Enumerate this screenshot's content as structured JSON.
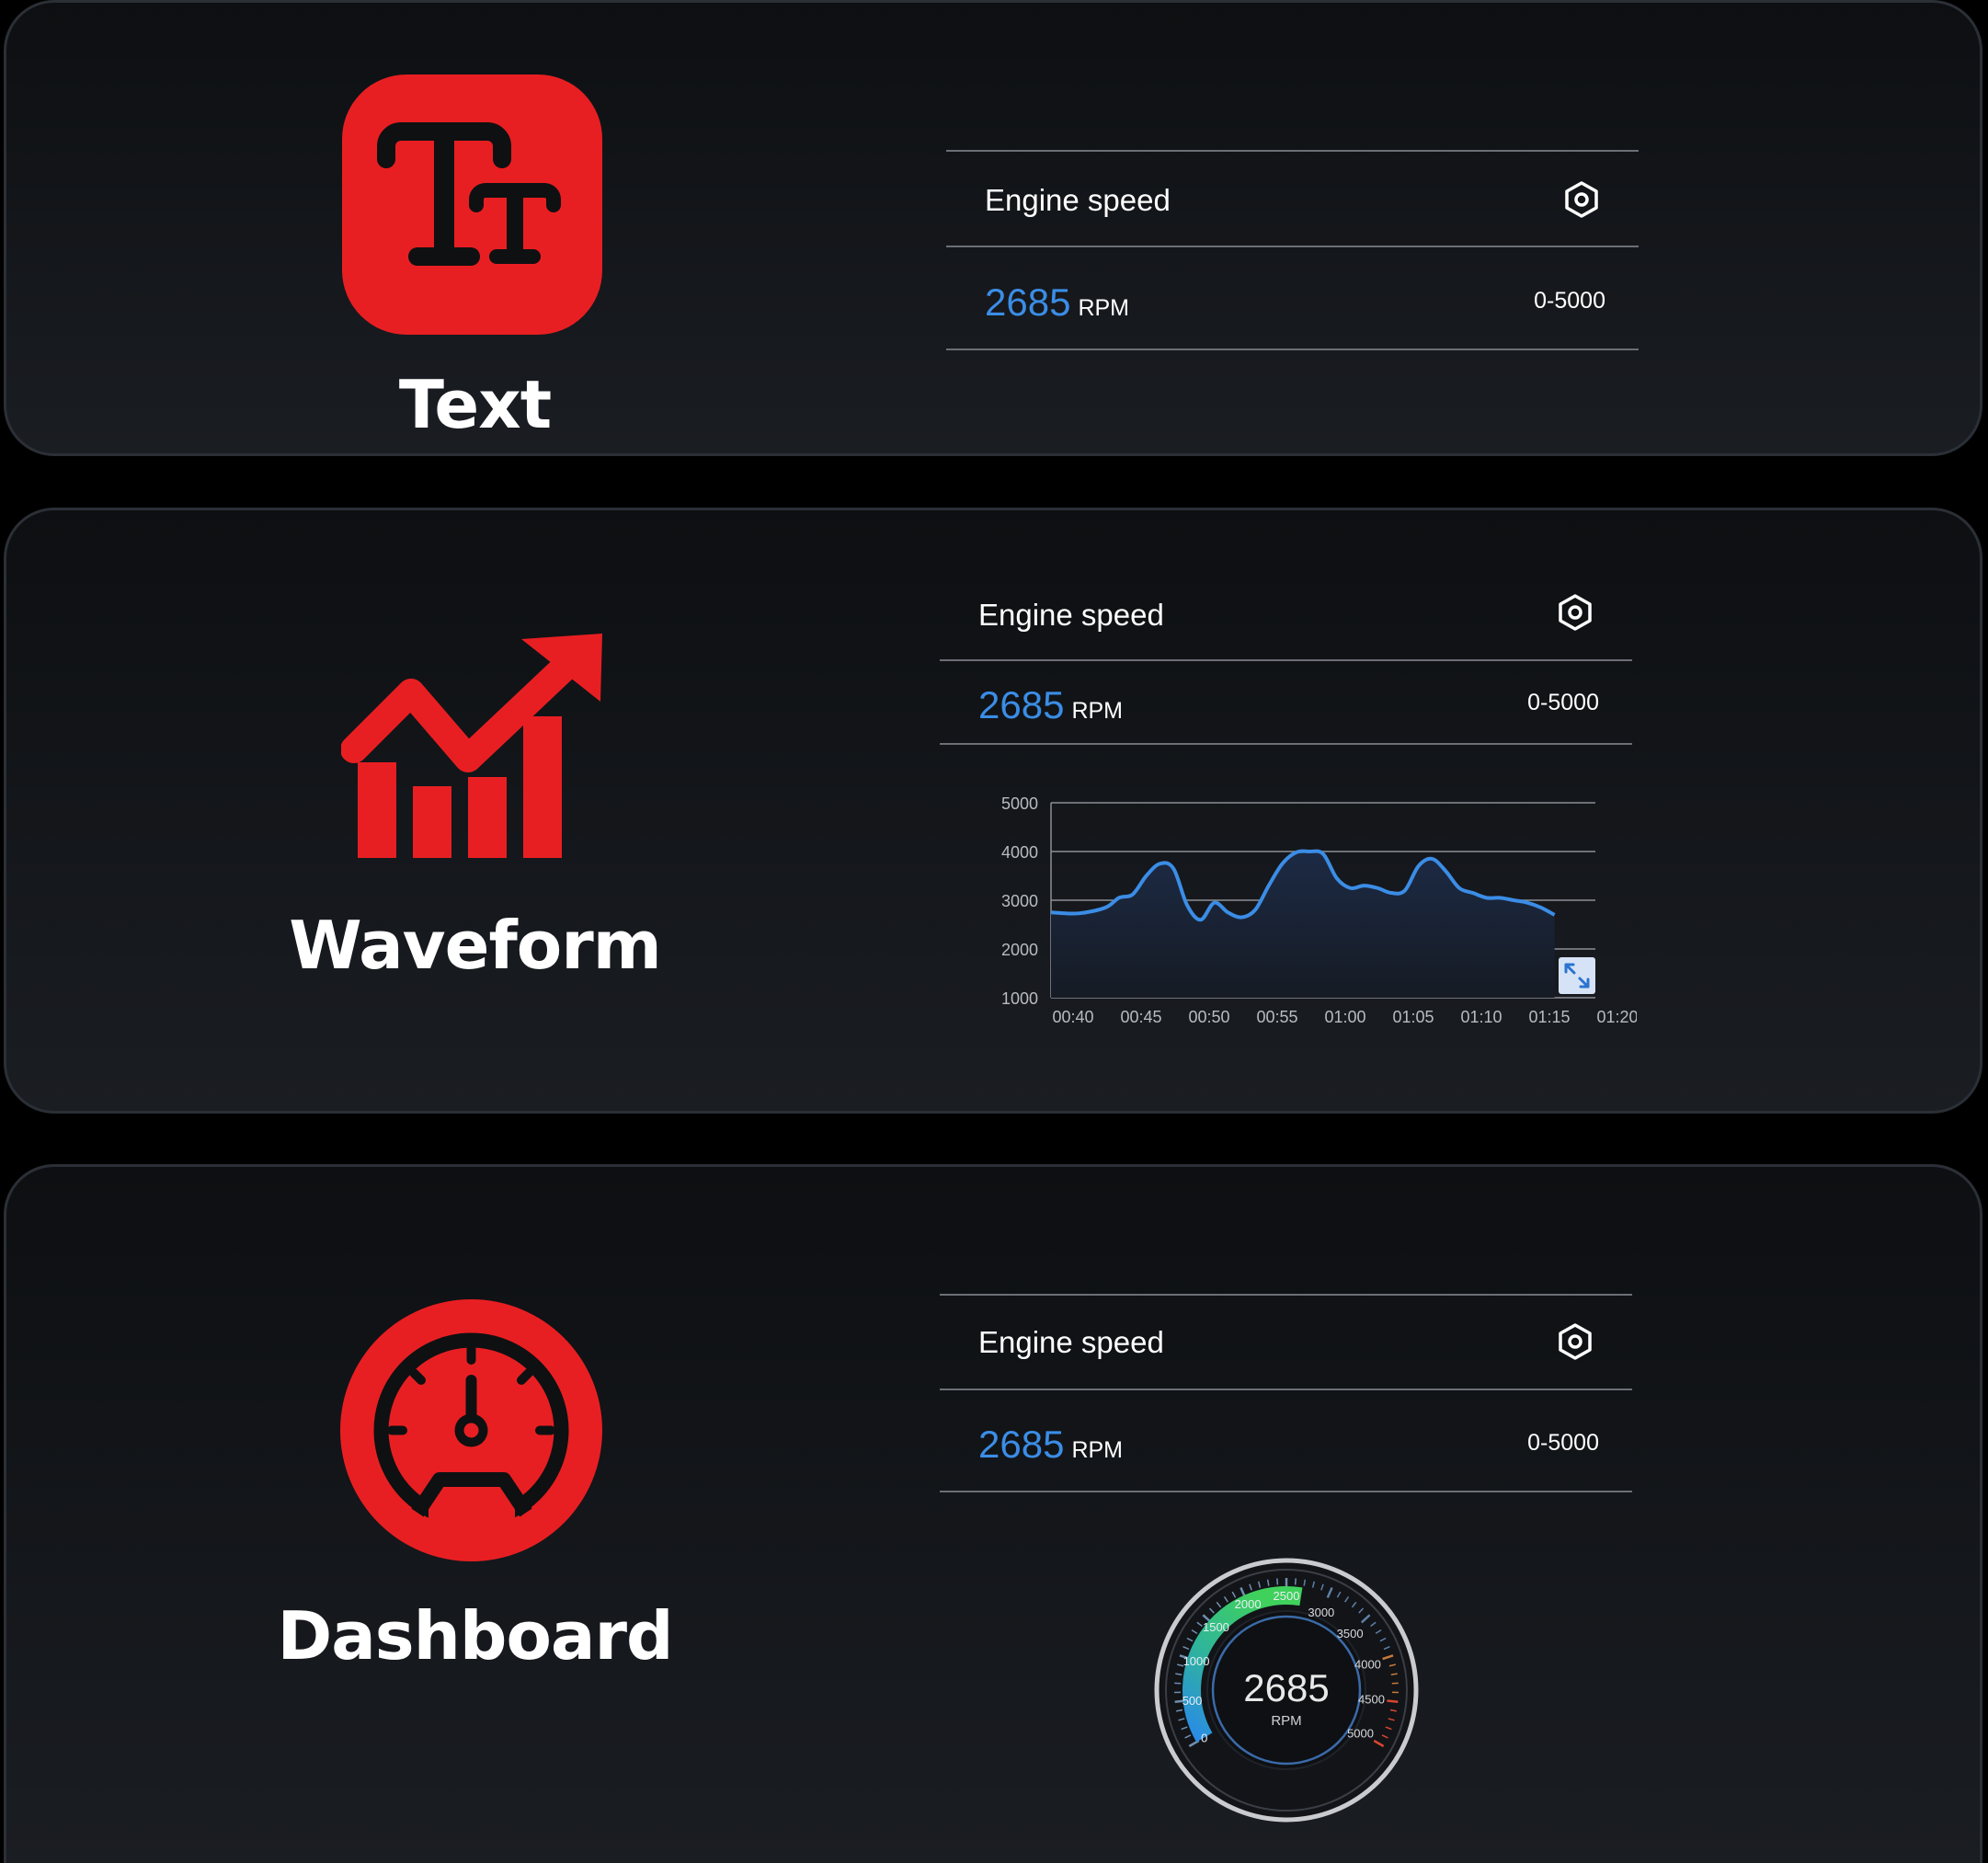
{
  "colors": {
    "accent_red": "#e81f22",
    "value_blue": "#3b8de6",
    "gauge_green": "#3fd15c",
    "gauge_blue": "#2a8ae8"
  },
  "modes": [
    {
      "title": "Text",
      "icon": "text-size-icon",
      "widget": {
        "title": "Engine speed",
        "value": "2685",
        "unit": "RPM",
        "range": "0-5000",
        "settings_icon": "settings-hexagon-icon"
      }
    },
    {
      "title": "Waveform",
      "icon": "trending-up-chart-icon",
      "widget": {
        "title": "Engine speed",
        "value": "2685",
        "unit": "RPM",
        "range": "0-5000",
        "settings_icon": "settings-hexagon-icon",
        "expand_icon": "expand-arrows-icon"
      }
    },
    {
      "title": "Dashboard",
      "icon": "speedometer-icon",
      "widget": {
        "title": "Engine speed",
        "value": "2685",
        "unit": "RPM",
        "range": "0-5000",
        "settings_icon": "settings-hexagon-icon"
      }
    }
  ],
  "chart_data": [
    {
      "type": "area",
      "x": [
        "00:40",
        "00:42",
        "00:44",
        "00:45",
        "00:46",
        "00:47",
        "00:48",
        "00:49",
        "00:50",
        "00:51",
        "00:52",
        "00:53",
        "00:54",
        "00:55",
        "00:56",
        "00:57",
        "00:58",
        "00:59",
        "01:00",
        "01:01",
        "01:02",
        "01:03",
        "01:04",
        "01:05",
        "01:06",
        "01:07",
        "01:08",
        "01:09",
        "01:10",
        "01:11",
        "01:12",
        "01:13",
        "01:14",
        "01:15",
        "01:16",
        "01:17"
      ],
      "y": [
        2750,
        2730,
        2850,
        3050,
        3120,
        3500,
        3750,
        3650,
        2900,
        2600,
        2950,
        2750,
        2650,
        2800,
        3300,
        3750,
        3980,
        4000,
        3950,
        3450,
        3250,
        3300,
        3250,
        3150,
        3200,
        3700,
        3850,
        3600,
        3250,
        3150,
        3050,
        3050,
        3000,
        2950,
        2850,
        2700
      ],
      "x_ticks": [
        "00:40",
        "00:45",
        "00:50",
        "00:55",
        "01:00",
        "01:05",
        "01:10",
        "01:15",
        "01:20"
      ],
      "y_ticks": [
        "1000",
        "2000",
        "3000",
        "4000",
        "5000"
      ],
      "ylim": [
        1000,
        5000
      ],
      "xlim": [
        "00:40",
        "01:20"
      ],
      "grid": true
    },
    {
      "type": "gauge",
      "value": 2685,
      "value_label": "2685",
      "unit_label": "RPM",
      "range": [
        0,
        5000
      ],
      "tick_labels": [
        "0",
        "500",
        "1000",
        "1500",
        "2000",
        "2500",
        "3000",
        "3500",
        "4000",
        "4500",
        "5000"
      ]
    }
  ]
}
